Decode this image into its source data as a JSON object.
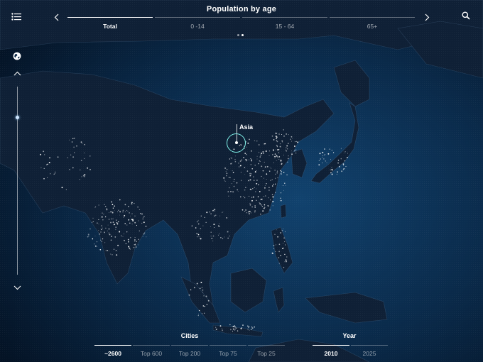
{
  "header": {
    "title": "Population by age",
    "tabs": [
      {
        "label": "Total",
        "active": true
      },
      {
        "label": "0 -14",
        "active": false
      },
      {
        "label": "15 - 64",
        "active": false
      },
      {
        "label": "65+",
        "active": false
      }
    ],
    "page_dots": 2,
    "active_dot": 1
  },
  "map": {
    "region_label": "Asia"
  },
  "cities": {
    "label": "Cities",
    "options": [
      {
        "label": "~2600",
        "active": true
      },
      {
        "label": "Top 600",
        "active": false
      },
      {
        "label": "Top 200",
        "active": false
      },
      {
        "label": "Top 75",
        "active": false
      },
      {
        "label": "Top 25",
        "active": false
      }
    ]
  },
  "year": {
    "label": "Year",
    "options": [
      {
        "label": "2010",
        "active": true
      },
      {
        "label": "2025",
        "active": false
      }
    ]
  },
  "colors": {
    "ocean": "#0a2746",
    "land": "#0f1f33",
    "marker": "#7ff0e8",
    "city_light": "#ffffff"
  },
  "icons": [
    "list-icon",
    "chevron-left-icon",
    "chevron-right-icon",
    "search-icon",
    "globe-icon",
    "chevron-up-icon",
    "chevron-down-icon"
  ]
}
